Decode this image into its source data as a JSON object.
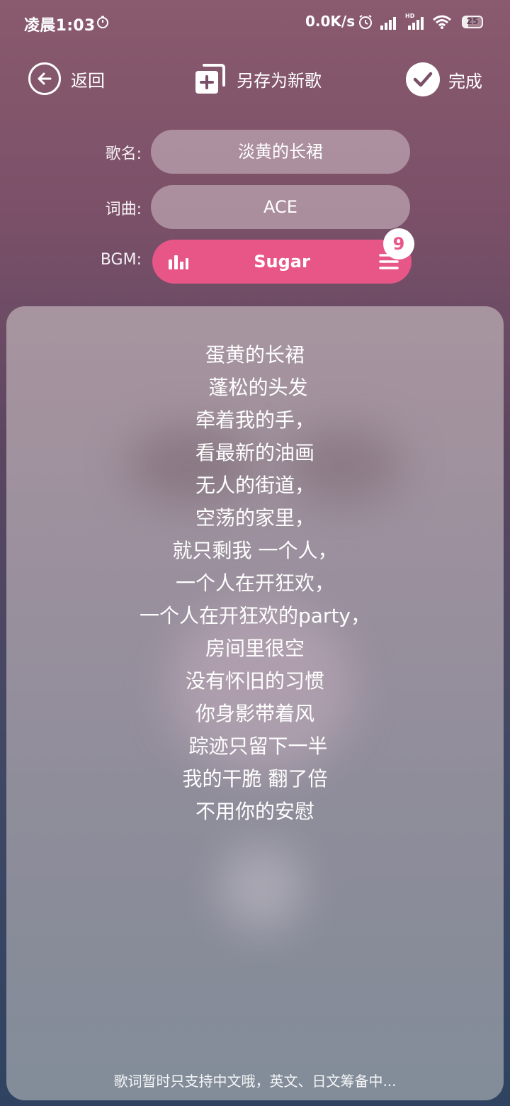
{
  "status_bar": {
    "time": "凌晨1:03",
    "net_speed": "0.0K/s",
    "hd_label": "HD",
    "battery_level": "25"
  },
  "toolbar": {
    "back_label": "返回",
    "save_as_label": "另存为新歌",
    "done_label": "完成"
  },
  "form": {
    "song_name_label": "歌名:",
    "song_name_value": "淡黄的长裙",
    "lyricist_label": "词曲:",
    "lyricist_value": "ACE",
    "bgm_label": "BGM:",
    "bgm_value": "Sugar",
    "bgm_count": "9"
  },
  "lyrics": {
    "lines": [
      "蛋黄的长裙",
      " 蓬松的头发",
      "牵着我的手，",
      "看最新的油画",
      "无人的街道，",
      "空荡的家里，",
      "就只剩我 一个人，",
      "一个人在开狂欢，",
      "一个人在开狂欢的party，",
      "房间里很空",
      "没有怀旧的习惯",
      "你身影带着风",
      " 踪迹只留下一半",
      "我的干脆 翻了倍",
      "不用你的安慰"
    ],
    "note": "歌词暂时只支持中文哦，英文、日文筹备中..."
  },
  "colors": {
    "accent_pink": "#e85688",
    "field_bg": "#c8b4c0"
  }
}
